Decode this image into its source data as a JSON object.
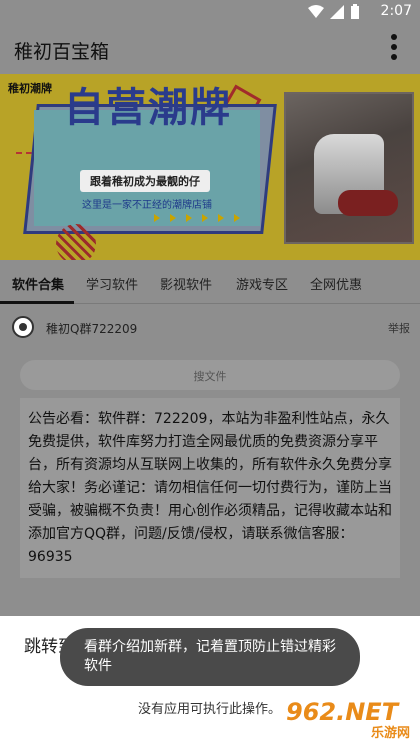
{
  "status_bar": {
    "time": "2:07",
    "icons": [
      "wifi-icon",
      "signal-icon",
      "battery-icon"
    ]
  },
  "app_bar": {
    "title": "稚初百宝箱",
    "menu_icon": "more-vert-icon"
  },
  "banner": {
    "corner_label": "稚初潮牌",
    "headline": "自营潮牌",
    "tagline": "跟着稚初成为最靓的仔",
    "subline": "这里是一家不正经的潮牌店铺"
  },
  "tabs": [
    {
      "label": "软件合集",
      "active": true
    },
    {
      "label": "学习软件",
      "active": false
    },
    {
      "label": "影视软件",
      "active": false
    },
    {
      "label": "游戏专区",
      "active": false
    },
    {
      "label": "全网优惠",
      "active": false
    }
  ],
  "group": {
    "name": "稚初Q群722209",
    "report_label": "举报"
  },
  "search": {
    "placeholder": "搜文件"
  },
  "notice": {
    "text": "公告必看：软件群：722209，本站为非盈利性站点，永久免费提供，软件库努力打造全网最优质的免费资源分享平台，所有资源均从互联网上收集的，所有软件永久免费分享给大家！务必谨记：请勿相信任何一切付费行为，谨防上当受骗，被骗概不负责！用心创作必须精品，记得收藏本站和添加官方QQ群，问题/反馈/侵权，请联系微信客服：96935"
  },
  "sheet": {
    "title": "跳转到QQ群",
    "empty_text": "没有应用可执行此操作。"
  },
  "toast": {
    "text": "看群介绍加新群，记着置顶防止错过精彩软件"
  },
  "watermark": {
    "main": "962.NET",
    "sub": "乐游网"
  },
  "colors": {
    "banner_bg": "#b8a327",
    "headline": "#2a3b8c",
    "overlay": "#8e8e8e",
    "toast_bg": "#4a4a4a"
  }
}
